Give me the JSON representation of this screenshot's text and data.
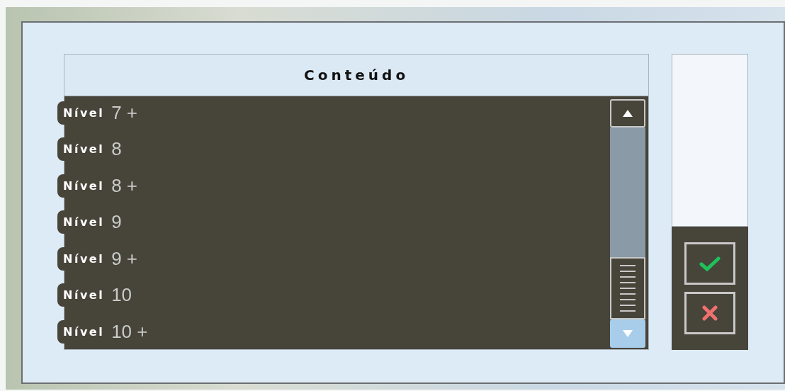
{
  "list": {
    "header": "Conteúdo",
    "rows": [
      {
        "badge": "Nível",
        "value": "7 +"
      },
      {
        "badge": "Nível",
        "value": "8"
      },
      {
        "badge": "Nível",
        "value": "8 +"
      },
      {
        "badge": "Nível",
        "value": "9"
      },
      {
        "badge": "Nível",
        "value": "9 +"
      },
      {
        "badge": "Nível",
        "value": "10"
      },
      {
        "badge": "Nível",
        "value": "10 +"
      }
    ]
  }
}
